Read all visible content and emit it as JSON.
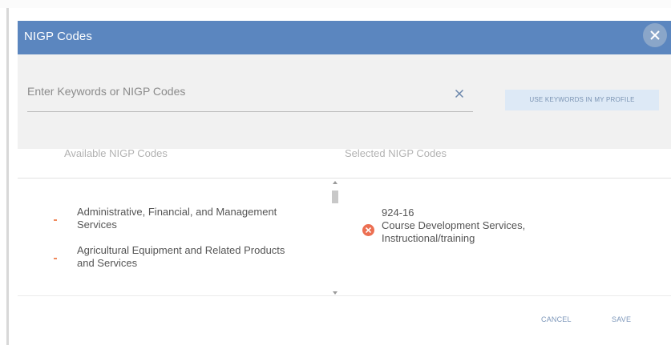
{
  "dialog": {
    "title": "NIGP Codes"
  },
  "search": {
    "placeholder": "Enter Keywords or NIGP Codes",
    "keywords_button_label": "USE KEYWORDS IN MY PROFILE"
  },
  "columns": {
    "available_header": "Available NIGP Codes",
    "selected_header": "Selected NIGP Codes"
  },
  "available_codes": [
    {
      "label": "Administrative, Financial, and Management Services"
    },
    {
      "label": "Agricultural Equipment and Related Products and Services"
    }
  ],
  "selected_codes": [
    {
      "code": "924-16",
      "name": "Course Development Services, Instructional/training"
    }
  ],
  "footer": {
    "cancel_label": "CANCEL",
    "save_label": "SAVE"
  },
  "colors": {
    "header_blue": "#5b86bf",
    "accent_orange": "#ec6f52",
    "link_blue": "#7d97ba"
  },
  "icons": {
    "close": "close-icon",
    "clear_search": "clear-search-icon",
    "remove_selected": "remove-circle-icon",
    "list_bullet": "bullet-icon"
  }
}
